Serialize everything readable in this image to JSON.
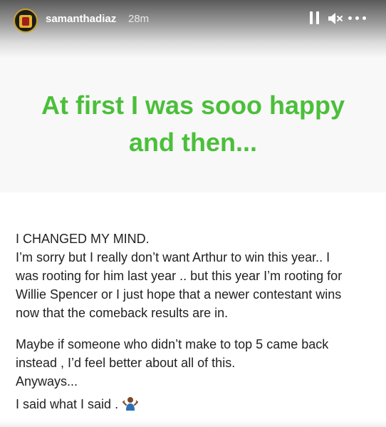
{
  "header": {
    "username": "samanthadiaz",
    "time": "28m",
    "icons": [
      "avatar",
      "pause-icon",
      "mute-icon",
      "more-icon"
    ]
  },
  "headline": {
    "line1": "At first I was sooo happy",
    "line2": "and then...",
    "color": "#4bbf3a"
  },
  "body": {
    "line1": "I CHANGED MY MIND.",
    "line2": "I’m sorry but I really don’t want Arthur to win this year.. I",
    "line3": "was rooting for him last year .. but this year I’m rooting for",
    "line4": "Willie Spencer or I just hope that a newer contestant wins",
    "line5": "now that the comeback results are in.",
    "line6": "Maybe if someone who didn’t make to top 5  came back",
    "line7": "instead , I’d feel better about all of this.",
    "line8": "Anyways...",
    "line9": "I said what I said .",
    "emoji": "shrug-icon"
  }
}
